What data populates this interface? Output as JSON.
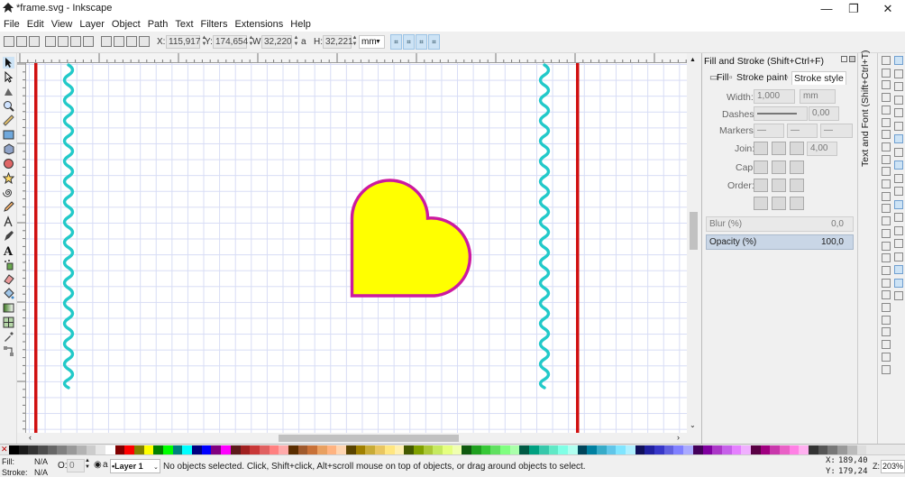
{
  "window": {
    "title": "*frame.svg - Inkscape",
    "minimize": "—",
    "maximize": "❐",
    "close": "✕"
  },
  "menu": [
    "File",
    "Edit",
    "View",
    "Layer",
    "Object",
    "Path",
    "Text",
    "Filters",
    "Extensions",
    "Help"
  ],
  "toolbar": {
    "x_label": "X:",
    "x_value": "115,917",
    "y_label": "Y:",
    "y_value": "174,654",
    "w_label": "W:",
    "w_value": "32,220",
    "lock_label": "a",
    "h_label": "H:",
    "h_value": "32,221",
    "unit": "mm"
  },
  "panel": {
    "title": "Fill and Stroke (Shift+Ctrl+F)",
    "tabs": [
      "Fill",
      "Stroke paint",
      "Stroke style"
    ],
    "width_label": "Width:",
    "width_value": "1,000",
    "width_unit": "mm",
    "dashes_label": "Dashes:",
    "dashes_value": "0,00",
    "markers_label": "Markers:",
    "join_label": "Join:",
    "join_value": "4,00",
    "cap_label": "Cap:",
    "order_label": "Order:",
    "blur_label": "Blur (%)",
    "blur_value": "0,0",
    "opacity_label": "Opacity (%)",
    "opacity_value": "100,0"
  },
  "vertical_tab": "Text and Font (Shift+Ctrl+T)",
  "status": {
    "fill_label": "Fill:",
    "fill_value": "N/A",
    "stroke_label": "Stroke:",
    "stroke_value": "N/A",
    "opacity_label": "O:",
    "opacity_value": "0",
    "layer": "•Layer 1",
    "message": "No objects selected. Click, Shift+click, Alt+scroll mouse on top of objects, or drag around objects to select.",
    "x_label": "X:",
    "x_value": "189,40",
    "y_label": "Y:",
    "y_value": "179,24",
    "z_label": "Z:",
    "z_value": "203%"
  },
  "colors": {
    "accent_red": "#d01010",
    "wave_cyan": "#22c9c9",
    "heart_fill": "#ffff00",
    "heart_stroke": "#cc1aa0",
    "grid": "#d7dcf5"
  },
  "palette": [
    "#000000",
    "#1a1a1a",
    "#333333",
    "#4d4d4d",
    "#666666",
    "#808080",
    "#999999",
    "#b3b3b3",
    "#cccccc",
    "#e6e6e6",
    "#ffffff",
    "#800000",
    "#ff0000",
    "#808000",
    "#ffff00",
    "#008000",
    "#00ff00",
    "#008080",
    "#00ffff",
    "#000080",
    "#0000ff",
    "#800080",
    "#ff00ff",
    "#5c1a1a",
    "#a02020",
    "#c83737",
    "#e06060",
    "#ff8080",
    "#ffaaaa",
    "#5a2d00",
    "#a05a2c",
    "#c87137",
    "#e9a060",
    "#ffb380",
    "#ffd5b0",
    "#5a4400",
    "#a08000",
    "#c8ab37",
    "#e9c660",
    "#ffe680",
    "#fff0b0",
    "#445a00",
    "#80a000",
    "#abc837",
    "#c6e960",
    "#e5ff80",
    "#f0ffb0",
    "#105a10",
    "#20a020",
    "#37c837",
    "#60e060",
    "#80ff80",
    "#aaffaa",
    "#005a44",
    "#00a080",
    "#37c8ab",
    "#60e9c6",
    "#80ffe6",
    "#b0fff0",
    "#00445a",
    "#0080a0",
    "#37abc8",
    "#60c6e9",
    "#80e5ff",
    "#b0f0ff",
    "#10105a",
    "#2020a0",
    "#3737c8",
    "#6060e0",
    "#8080ff",
    "#aaaaff",
    "#44005a",
    "#8000a0",
    "#ab37c8",
    "#c660e9",
    "#e580ff",
    "#f0b0ff",
    "#5a0044",
    "#a00080",
    "#c837ab",
    "#e960c6",
    "#ff80e5",
    "#ffb0f0",
    "#333333",
    "#555555",
    "#777777",
    "#999999",
    "#bbbbbb",
    "#dddddd"
  ],
  "tool_icons": [
    "select-arrow-icon",
    "node-edit-icon",
    "tweak-icon",
    "zoom-icon",
    "measure-icon",
    "rectangle-icon",
    "3d-box-icon",
    "ellipse-icon",
    "star-icon",
    "spiral-icon",
    "pencil-icon",
    "pen-icon",
    "calligraphy-icon",
    "text-tool-icon",
    "spray-icon",
    "eraser-icon",
    "paint-bucket-icon",
    "gradient-icon",
    "mesh-icon",
    "dropper-icon",
    "connector-icon"
  ]
}
